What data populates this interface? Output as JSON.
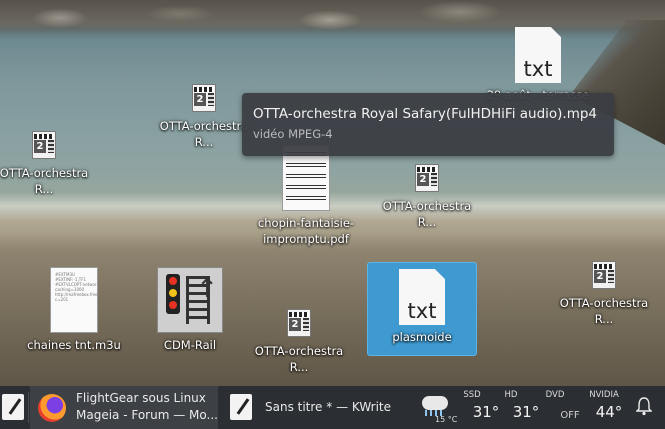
{
  "desktop": {
    "icons": [
      {
        "type": "video",
        "label": "OTTA-orchestra R..."
      },
      {
        "type": "video",
        "label": "OTTA-orchestra R..."
      },
      {
        "type": "txt",
        "glyph": "txt",
        "label": "29 août - terrasse"
      },
      {
        "type": "video",
        "label": "OTTA-orchestra R..."
      },
      {
        "type": "pdf",
        "label": "chopin-fantaisie-impromptu.pdf"
      },
      {
        "type": "video",
        "label": "OTTA-orchestra R..."
      },
      {
        "type": "m3u",
        "label": "chaines tnt.m3u",
        "preview": "#EXTM3U #EXTINF:-1,TF1 #EXTVLCOPT:network-caching=1000 http://mafreebox.freebox.fr/fbxtv_pub/stream_player.m3u8?c=201"
      },
      {
        "type": "cdm",
        "label": "CDM-Rail"
      },
      {
        "type": "video",
        "label": "OTTA-orchestra R..."
      },
      {
        "type": "txt",
        "glyph": "txt",
        "label": "plasmoide",
        "selected": true
      },
      {
        "type": "video",
        "label": "OTTA-orchestra R..."
      }
    ],
    "tooltip": {
      "title": "OTTA-orchestra Royal Safary(FulHDHiFi audio).mp4",
      "subtitle": "vidéo MPEG-4"
    }
  },
  "taskbar": {
    "tasks": [
      {
        "title_line1": "FlightGear sous Linux",
        "title_line2": "Mageia - Forum — Mo...",
        "icon": "firefox-icon",
        "active": true
      },
      {
        "title_line1": "Sans titre * — KWrite",
        "icon": "kwrite-icon",
        "active": false
      }
    ],
    "weather": {
      "temp": "15 °C",
      "icon": "cloud-rain-icon"
    },
    "sensors": [
      {
        "label": "SSD",
        "value": "31°"
      },
      {
        "label": "HD",
        "value": "31°"
      },
      {
        "label": "DVD",
        "value": "OFF"
      },
      {
        "label": "NVIDIA",
        "value": "44°"
      }
    ],
    "colors": {
      "panel": "#2b2e32",
      "selection": "#3e9ad0"
    }
  }
}
